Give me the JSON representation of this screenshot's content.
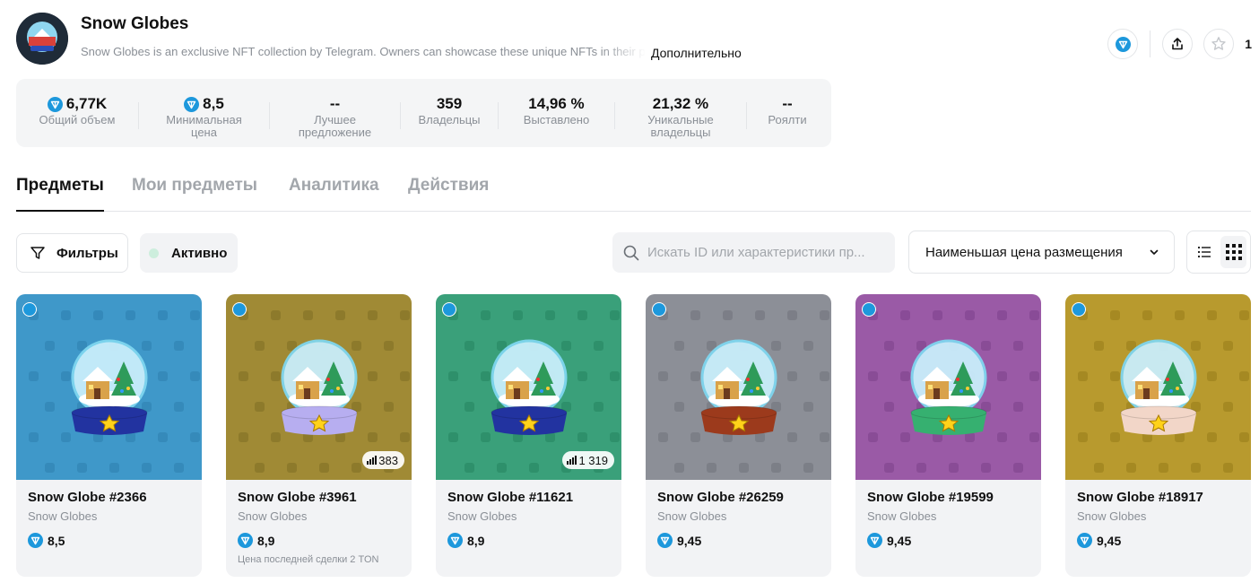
{
  "collection": {
    "name": "Snow Globes",
    "description": "Snow Globes is an exclusive NFT collection by Telegram. Owners can showcase these unique NFTs in their profiles.",
    "more_label": "Дополнительно",
    "favorites_count": "1"
  },
  "stats": [
    {
      "value": "6,77K",
      "label": "Общий объем",
      "ton": true
    },
    {
      "value": "8,5",
      "label": "Минимальная цена",
      "ton": true
    },
    {
      "value": "--",
      "label": "Лучшее предложение",
      "ton": false
    },
    {
      "value": "359",
      "label": "Владельцы",
      "ton": false
    },
    {
      "value": "14,96 %",
      "label": "Выставлено",
      "ton": false
    },
    {
      "value": "21,32 %",
      "label": "Уникальные владельцы",
      "ton": false
    },
    {
      "value": "--",
      "label": "Роялти",
      "ton": false
    }
  ],
  "tabs": [
    "Предметы",
    "Мои предметы",
    "Аналитика",
    "Действия"
  ],
  "toolbar": {
    "filters_label": "Фильтры",
    "active_label": "Активно",
    "search_placeholder": "Искать ID или характеристики пр...",
    "sort_label": "Наименьшая цена размещения"
  },
  "items": [
    {
      "name": "Snow Globe #2366",
      "collection": "Snow Globes",
      "price": "8,5",
      "sales": "",
      "last_sale": "",
      "bg": "#3f98c9",
      "pattern": "#2d7fae",
      "base": "#2233a0"
    },
    {
      "name": "Snow Globe #3961",
      "collection": "Snow Globes",
      "price": "8,9",
      "sales": "383",
      "last_sale": "Цена последней сделки 2 TON",
      "bg": "#a08a35",
      "pattern": "#7f6d23",
      "base": "#b7aef0"
    },
    {
      "name": "Snow Globe #11621",
      "collection": "Snow Globes",
      "price": "8,9",
      "sales": "1 319",
      "last_sale": "",
      "bg": "#3aa07a",
      "pattern": "#25835f",
      "base": "#2233a0"
    },
    {
      "name": "Snow Globe #26259",
      "collection": "Snow Globes",
      "price": "9,45",
      "sales": "",
      "last_sale": "",
      "bg": "#8c8f97",
      "pattern": "#6f727b",
      "base": "#9c3a1c"
    },
    {
      "name": "Snow Globe #19599",
      "collection": "Snow Globes",
      "price": "9,45",
      "sales": "",
      "last_sale": "",
      "bg": "#9a5aa6",
      "pattern": "#7c418a",
      "base": "#36b070"
    },
    {
      "name": "Snow Globe #18917",
      "collection": "Snow Globes",
      "price": "9,45",
      "sales": "",
      "last_sale": "",
      "bg": "#b89a2e",
      "pattern": "#977c1a",
      "base": "#f2d6c8"
    }
  ],
  "colors": {
    "accent": "#1d98dc",
    "active_dot": "#cdeedd"
  }
}
